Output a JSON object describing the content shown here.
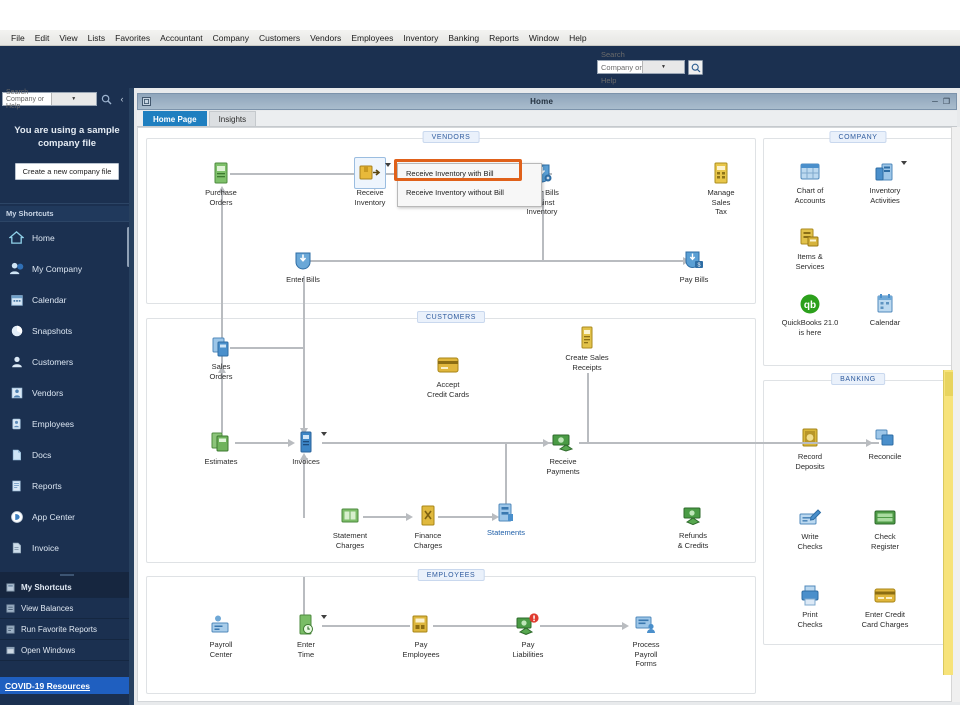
{
  "menubar": {
    "items": [
      "File",
      "Edit",
      "View",
      "Lists",
      "Favorites",
      "Accountant",
      "Company",
      "Customers",
      "Vendors",
      "Employees",
      "Inventory",
      "Banking",
      "Reports",
      "Window",
      "Help"
    ]
  },
  "toolbar": {
    "search_placeholder": "Search Company or Help",
    "search_icon": "magnifier-icon",
    "dropdown_icon": "chevron-down-icon"
  },
  "sidebar": {
    "search_placeholder": "Search Company or Help",
    "search_icon": "magnifier-icon",
    "collapse_icon": "chevron-left-icon",
    "sample_notice_line1": "You are using a sample",
    "sample_notice_line2": "company file",
    "new_file_button": "Create a new company file",
    "shortcuts_header": "My Shortcuts",
    "items": [
      {
        "label": "Home",
        "icon": "home-icon"
      },
      {
        "label": "My Company",
        "icon": "company-icon"
      },
      {
        "label": "Calendar",
        "icon": "calendar-icon"
      },
      {
        "label": "Snapshots",
        "icon": "piechart-icon"
      },
      {
        "label": "Customers",
        "icon": "person-icon"
      },
      {
        "label": "Vendors",
        "icon": "vendor-icon"
      },
      {
        "label": "Employees",
        "icon": "badge-icon"
      },
      {
        "label": "Docs",
        "icon": "document-icon"
      },
      {
        "label": "Reports",
        "icon": "report-icon"
      },
      {
        "label": "App Center",
        "icon": "appcenter-icon"
      },
      {
        "label": "Invoice",
        "icon": "invoice-icon"
      }
    ],
    "bottom_items": [
      {
        "label": "My Shortcuts",
        "icon": "shortcuts-icon",
        "selected": true
      },
      {
        "label": "View Balances",
        "icon": "balances-icon",
        "selected": false
      },
      {
        "label": "Run Favorite Reports",
        "icon": "favreports-icon",
        "selected": false
      },
      {
        "label": "Open Windows",
        "icon": "windows-icon",
        "selected": false
      }
    ],
    "covid_link": "COVID-19 Resources"
  },
  "window": {
    "title": "Home",
    "minimize_icon": "minimize-icon",
    "maximize_icon": "maximize-icon",
    "system_icon": "window-system-icon",
    "tabs": [
      {
        "label": "Home Page",
        "active": true
      },
      {
        "label": "Insights",
        "active": false
      }
    ]
  },
  "dropdown": {
    "items": [
      {
        "label": "Receive Inventory with Bill",
        "highlighted": true
      },
      {
        "label": "Receive Inventory without Bill",
        "highlighted": false
      }
    ],
    "highlight_color": "#e0611a"
  },
  "flow": {
    "sections": [
      {
        "label": "VENDORS"
      },
      {
        "label": "CUSTOMERS"
      },
      {
        "label": "EMPLOYEES"
      }
    ],
    "vendors_nodes": [
      {
        "id": "purchase-orders",
        "label": "Purchase\nOrders",
        "icon": "purchase-order-icon"
      },
      {
        "id": "receive-inventory",
        "label": "Receive\nInventory",
        "icon": "receive-inventory-icon",
        "has_dropdown": true,
        "selected": true
      },
      {
        "id": "enter-bills-against-inventory",
        "label": "Enter Bills\nAgainst\nInventory",
        "icon": "enter-bills-against-inventory-icon"
      },
      {
        "id": "manage-sales-tax",
        "label": "Manage\nSales\nTax",
        "icon": "sales-tax-icon"
      },
      {
        "id": "enter-bills",
        "label": "Enter Bills",
        "icon": "enter-bills-icon"
      },
      {
        "id": "pay-bills",
        "label": "Pay Bills",
        "icon": "pay-bills-icon"
      }
    ],
    "customers_nodes": [
      {
        "id": "sales-orders",
        "label": "Sales\nOrders",
        "icon": "sales-orders-icon"
      },
      {
        "id": "accept-credit-cards",
        "label": "Accept\nCredit Cards",
        "icon": "credit-card-icon"
      },
      {
        "id": "create-sales-receipts",
        "label": "Create Sales\nReceipts",
        "icon": "sales-receipt-icon"
      },
      {
        "id": "estimates",
        "label": "Estimates",
        "icon": "estimates-icon"
      },
      {
        "id": "invoices",
        "label": "Invoices",
        "icon": "invoice-icon",
        "has_dropdown": true
      },
      {
        "id": "receive-payments",
        "label": "Receive\nPayments",
        "icon": "receive-payments-icon"
      },
      {
        "id": "statement-charges",
        "label": "Statement\nCharges",
        "icon": "statement-charges-icon"
      },
      {
        "id": "finance-charges",
        "label": "Finance\nCharges",
        "icon": "finance-charges-icon"
      },
      {
        "id": "statements",
        "label": "Statements",
        "icon": "statements-icon"
      },
      {
        "id": "refunds-credits",
        "label": "Refunds\n& Credits",
        "icon": "refunds-icon"
      }
    ],
    "employees_nodes": [
      {
        "id": "payroll-center",
        "label": "Payroll\nCenter",
        "icon": "payroll-center-icon"
      },
      {
        "id": "enter-time",
        "label": "Enter\nTime",
        "icon": "enter-time-icon",
        "has_dropdown": true
      },
      {
        "id": "pay-employees",
        "label": "Pay\nEmployees",
        "icon": "pay-employees-icon"
      },
      {
        "id": "pay-liabilities",
        "label": "Pay\nLiabilities",
        "icon": "pay-liabilities-icon",
        "alert": true
      },
      {
        "id": "process-payroll-forms",
        "label": "Process\nPayroll\nForms",
        "icon": "payroll-forms-icon"
      }
    ]
  },
  "company_panel": {
    "label": "COMPANY",
    "nodes": [
      {
        "id": "chart-of-accounts",
        "label": "Chart of\nAccounts",
        "icon": "chart-of-accounts-icon"
      },
      {
        "id": "inventory-activities",
        "label": "Inventory\nActivities",
        "icon": "inventory-activities-icon",
        "has_dropdown": true
      },
      {
        "id": "items-services",
        "label": "Items &\nServices",
        "icon": "items-services-icon"
      },
      {
        "id": "quickbooks-21",
        "label": "QuickBooks 21.0\nis here",
        "icon": "quickbooks-logo-icon"
      },
      {
        "id": "calendar",
        "label": "Calendar",
        "icon": "calendar-icon"
      }
    ]
  },
  "banking_panel": {
    "label": "BANKING",
    "nodes": [
      {
        "id": "record-deposits",
        "label": "Record\nDeposits",
        "icon": "record-deposits-icon"
      },
      {
        "id": "reconcile",
        "label": "Reconcile",
        "icon": "reconcile-icon"
      },
      {
        "id": "write-checks",
        "label": "Write\nChecks",
        "icon": "write-checks-icon"
      },
      {
        "id": "check-register",
        "label": "Check\nRegister",
        "icon": "check-register-icon"
      },
      {
        "id": "print-checks",
        "label": "Print\nChecks",
        "icon": "print-checks-icon"
      },
      {
        "id": "enter-credit-card-charges",
        "label": "Enter Credit\nCard Charges",
        "icon": "credit-card-charges-icon"
      }
    ]
  },
  "colors": {
    "sidebar_bg": "#1b3050",
    "accent_blue": "#1f7fc0",
    "highlight_orange": "#e0611a",
    "covid_blue": "#1f5fc0",
    "scrollbar_yellow": "#f7e37a"
  }
}
